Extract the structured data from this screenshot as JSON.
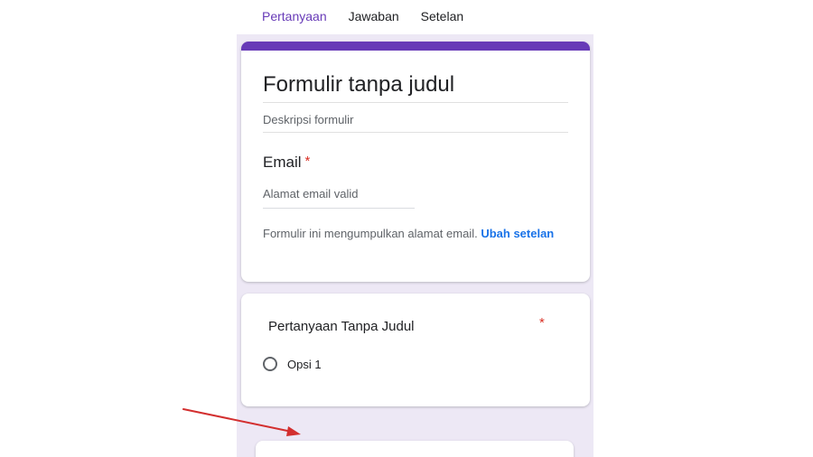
{
  "tabs": [
    {
      "label": "Pertanyaan",
      "active": true
    },
    {
      "label": "Jawaban",
      "active": false
    },
    {
      "label": "Setelan",
      "active": false
    }
  ],
  "form": {
    "title": "Formulir tanpa judul",
    "description_placeholder": "Deskripsi formulir",
    "email": {
      "label": "Email",
      "required_mark": "*",
      "placeholder": "Alamat email valid"
    },
    "notice": {
      "text": "Formulir ini mengumpulkan alamat email.",
      "link": "Ubah setelan"
    }
  },
  "question": {
    "title": "Pertanyaan Tanpa Judul",
    "required_mark": "*",
    "options": [
      {
        "label": "Opsi 1"
      }
    ]
  },
  "colors": {
    "accent": "#673ab7",
    "link": "#1a73e8",
    "required": "#d93025",
    "form_background": "#ede8f5",
    "annotation_arrow": "#d32f2f"
  },
  "icons": {
    "radio": "radio-button-unchecked-icon",
    "arrow": "red-annotation-arrow-icon"
  }
}
